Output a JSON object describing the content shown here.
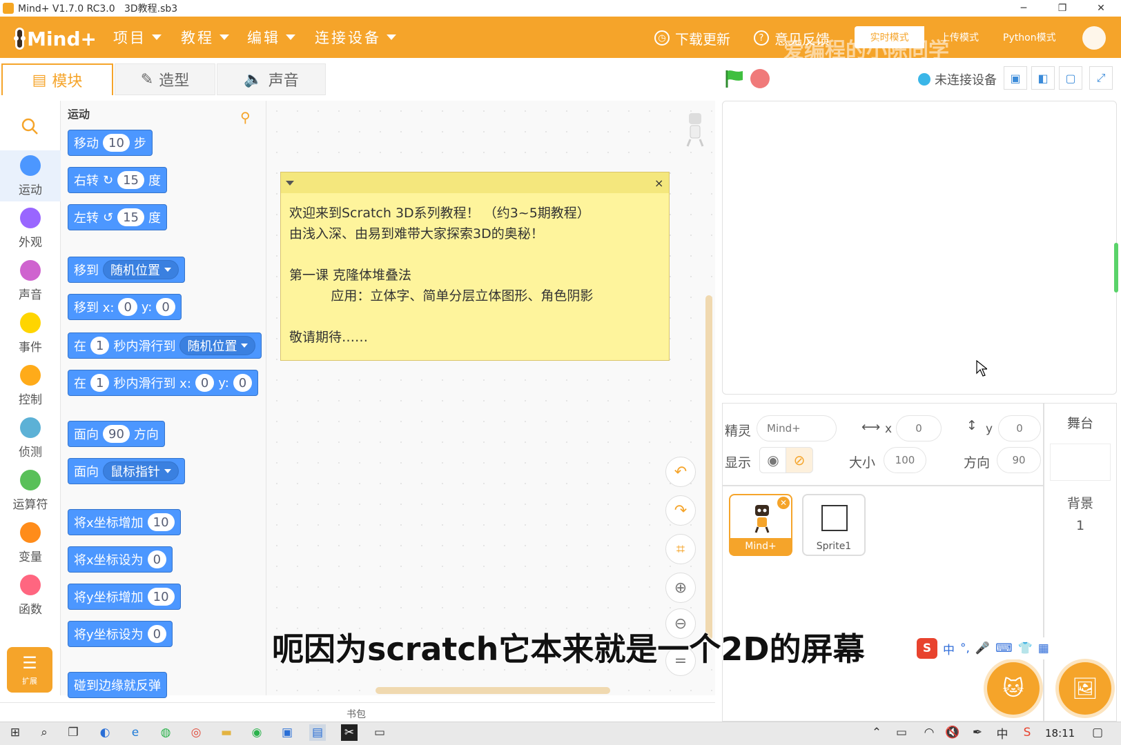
{
  "window": {
    "title": "Mind+ V1.7.0 RC3.0   3D教程.sb3",
    "minimize": "─",
    "restore": "❐",
    "close": "✕"
  },
  "menubar": {
    "logo": "Mind+",
    "items": [
      {
        "label": "项目"
      },
      {
        "label": "教程"
      },
      {
        "label": "编辑"
      },
      {
        "label": "连接设备"
      }
    ],
    "download_update": "下载更新",
    "feedback": "意见反馈",
    "modes": [
      "实时模式",
      "上传模式",
      "Python模式"
    ],
    "watermark": "爱编程的小陈同学"
  },
  "tabs": [
    {
      "label": "模块",
      "icon": "blocks-icon"
    },
    {
      "label": "造型",
      "icon": "brush-icon"
    },
    {
      "label": "声音",
      "icon": "speaker-icon"
    }
  ],
  "device_status": "未连接设备",
  "categories": [
    {
      "label": "运动",
      "color": "#4c97ff"
    },
    {
      "label": "外观",
      "color": "#9966ff"
    },
    {
      "label": "声音",
      "color": "#cf63cf"
    },
    {
      "label": "事件",
      "color": "#ffd500"
    },
    {
      "label": "控制",
      "color": "#ffab19"
    },
    {
      "label": "侦测",
      "color": "#5cb1d6"
    },
    {
      "label": "运算符",
      "color": "#59c059"
    },
    {
      "label": "变量",
      "color": "#ff8c1a"
    },
    {
      "label": "函数",
      "color": "#ff6680"
    }
  ],
  "extension_label": "扩展",
  "palette": {
    "heading": "运动",
    "blocks": {
      "move": {
        "a": "移动",
        "n": "10",
        "b": "步"
      },
      "turn_right": {
        "a": "右转",
        "n": "15",
        "b": "度"
      },
      "turn_left": {
        "a": "左转",
        "n": "15",
        "b": "度"
      },
      "goto": {
        "a": "移到",
        "dd": "随机位置"
      },
      "goto_xy": {
        "a": "移到 x:",
        "x": "0",
        "y_label": "y:",
        "y": "0"
      },
      "glide": {
        "a": "在",
        "n": "1",
        "b": "秒内滑行到",
        "dd": "随机位置"
      },
      "glide_xy": {
        "a": "在",
        "n": "1",
        "b": "秒内滑行到 x:",
        "x": "0",
        "y_label": "y:",
        "y": "0"
      },
      "point_dir": {
        "a": "面向",
        "n": "90",
        "b": "方向"
      },
      "point_towards": {
        "a": "面向",
        "dd": "鼠标指针"
      },
      "change_x": {
        "a": "将x坐标增加",
        "n": "10"
      },
      "set_x": {
        "a": "将x坐标设为",
        "n": "0"
      },
      "change_y": {
        "a": "将y坐标增加",
        "n": "10"
      },
      "set_y": {
        "a": "将y坐标设为",
        "n": "0"
      },
      "bounce": {
        "a": "碰到边缘就反弹"
      }
    }
  },
  "note": {
    "lines": [
      "欢迎来到Scratch 3D系列教程！ （约3~5期教程）",
      "由浅入深、由易到难带大家探索3D的奥秘！",
      "",
      "第一课 克隆体堆叠法",
      "          应用：立体字、简单分层立体图形、角色阴影",
      "",
      "敬请期待……"
    ],
    "close": "×"
  },
  "backpack": "书包",
  "sprite_info": {
    "sprite_label": "精灵",
    "sprite_name": "Mind+",
    "x_label": "x",
    "x": "0",
    "y_label": "y",
    "y": "0",
    "show_label": "显示",
    "size_label": "大小",
    "size": "100",
    "direction_label": "方向",
    "direction": "90"
  },
  "sprites": [
    {
      "name": "Mind+"
    },
    {
      "name": "Sprite1"
    }
  ],
  "stage_panel": {
    "title": "舞台",
    "backdrop_label": "背景",
    "backdrop_count": "1"
  },
  "subtitle": "呃因为scratch它本来就是一个2D的屏幕",
  "ime": {
    "logo": "S",
    "items": [
      "中",
      "°,",
      "🎤",
      "⌨",
      "👕",
      "▦"
    ]
  },
  "taskbar": {
    "time": "18:11",
    "lang": "中"
  }
}
